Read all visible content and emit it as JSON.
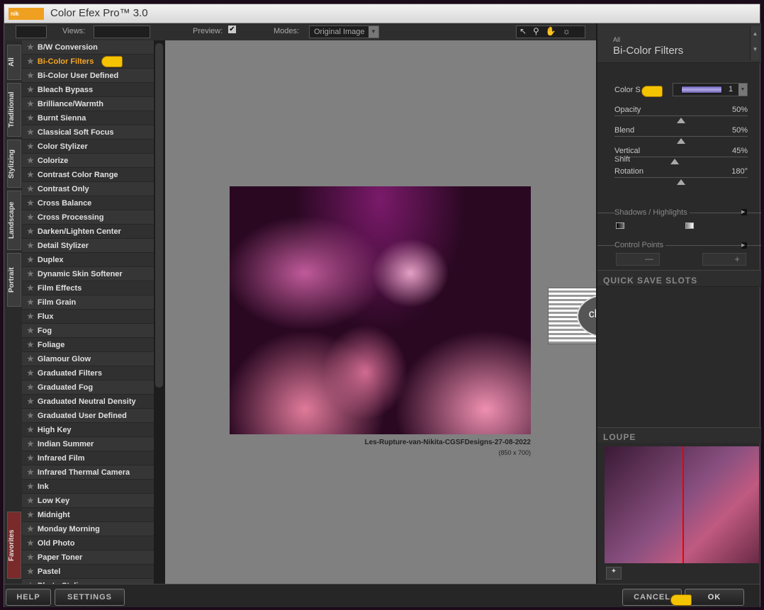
{
  "app": {
    "title": "Color Efex Pro™ 3.0",
    "logo": "nik Software"
  },
  "toolbar": {
    "views_label": "Views:",
    "preview_label": "Preview:",
    "preview_checked": true,
    "modes_label": "Modes:",
    "modes_value": "Original Image"
  },
  "tabs": [
    "All",
    "Traditional",
    "Stylizing",
    "Landscape",
    "Portrait",
    "Favorites"
  ],
  "filters": [
    "B/W Conversion",
    "Bi-Color Filters",
    "Bi-Color User Defined",
    "Bleach Bypass",
    "Brilliance/Warmth",
    "Burnt Sienna",
    "Classical Soft Focus",
    "Color Stylizer",
    "Colorize",
    "Contrast Color Range",
    "Contrast Only",
    "Cross Balance",
    "Cross Processing",
    "Darken/Lighten Center",
    "Detail Stylizer",
    "Duplex",
    "Dynamic Skin Softener",
    "Film Effects",
    "Film Grain",
    "Flux",
    "Fog",
    "Foliage",
    "Glamour Glow",
    "Graduated Filters",
    "Graduated Fog",
    "Graduated Neutral Density",
    "Graduated User Defined",
    "High Key",
    "Indian Summer",
    "Infrared Film",
    "Infrared Thermal Camera",
    "Ink",
    "Low Key",
    "Midnight",
    "Monday Morning",
    "Old Photo",
    "Paper Toner",
    "Pastel",
    "Photo Stylizer"
  ],
  "selected_filter": "Bi-Color Filters",
  "preview": {
    "caption": "Les-Rupture-van-Nikita-CGSFDesigns-27-08-2022",
    "dims": "(850 x 700)",
    "watermark": "claudia"
  },
  "panel": {
    "category": "All",
    "title": "Bi-Color Filters",
    "color_set_label": "Color S",
    "color_set_value": "1",
    "color_set_swatch": "#8a80d0",
    "sliders": [
      {
        "label": "Opacity",
        "value": "50%",
        "pos": 0.5
      },
      {
        "label": "Blend",
        "value": "50%",
        "pos": 0.5
      },
      {
        "label": "Vertical Shift",
        "value": "45%",
        "pos": 0.45
      },
      {
        "label": "Rotation",
        "value": "180°",
        "pos": 0.5
      }
    ],
    "shadows_label": "Shadows / Highlights",
    "control_points_label": "Control Points",
    "quick_save": "QUICK SAVE SLOTS",
    "loupe": "LOUPE"
  },
  "footer": {
    "help": "HELP",
    "settings": "SETTINGS",
    "cancel": "CANCEL",
    "ok": "OK"
  },
  "colors": {
    "accent": "#f5a623",
    "preview_bg": "#808080"
  }
}
